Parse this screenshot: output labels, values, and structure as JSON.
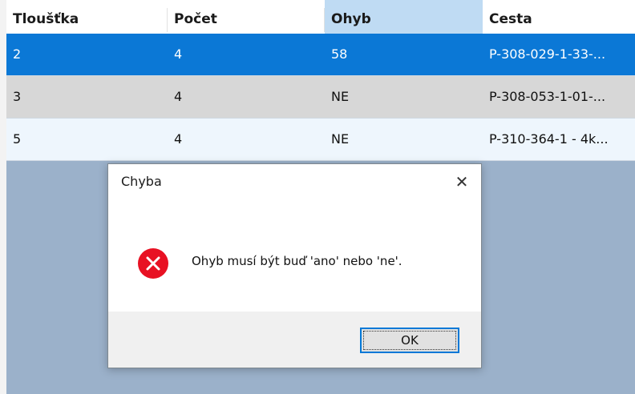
{
  "grid": {
    "columns": [
      "Tloušťka",
      "Počet",
      "Ohyb",
      "Cesta"
    ],
    "sorted_column": "Ohyb",
    "rows": [
      {
        "cells": [
          "2",
          "4",
          "58",
          "P-308-029-1-33-..."
        ],
        "state": "selected"
      },
      {
        "cells": [
          "3",
          "4",
          "NE",
          "P-308-053-1-01-..."
        ],
        "state": "gray"
      },
      {
        "cells": [
          "5",
          "4",
          "NE",
          "P-310-364-1 - 4k..."
        ],
        "state": "light"
      }
    ]
  },
  "dialog": {
    "title": "Chyba",
    "message": "Ohyb musí být buď 'ano' nebo 'ne'.",
    "ok_label": "OK",
    "close_glyph": "✕",
    "icon": "error-icon"
  },
  "colors": {
    "selection": "#0b78d6",
    "sorted_header": "#bfdbf3",
    "backdrop": "#9bb1ca",
    "error": "#e81123"
  }
}
